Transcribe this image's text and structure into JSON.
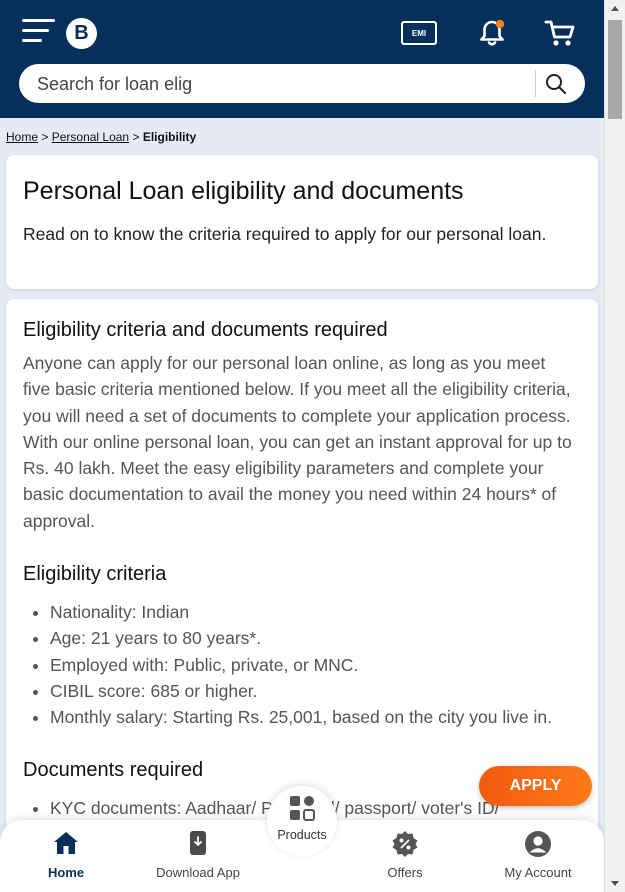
{
  "header": {
    "emi_label": "EMI",
    "logo_letter": "B",
    "search_placeholder": "Search for loan elig"
  },
  "breadcrumb": {
    "items": [
      "Home",
      "Personal Loan"
    ],
    "separator": ">",
    "current": "Eligibility"
  },
  "intro_card": {
    "title": "Personal Loan eligibility and documents",
    "text": "Read on to know the criteria required to apply for our personal loan."
  },
  "content": {
    "section1_heading": "Eligibility criteria and documents required",
    "section1_text": "Anyone can apply for our personal loan online, as long as you meet five basic criteria mentioned below. If you meet all the eligibility criteria, you will need a set of documents to complete your application process. With our online personal loan, you can get an instant approval for up to Rs. 40 lakh. Meet the easy eligibility parameters and complete your basic documentation to avail the money you need within 24 hours* of approval.",
    "eligibility_heading": "Eligibility criteria",
    "eligibility_items": [
      "Nationality: Indian",
      "Age: 21 years to 80 years*.",
      "Employed with: Public, private, or MNC.",
      "CIBIL score: 685 or higher.",
      "Monthly salary: Starting Rs. 25,001, based on the city you live in."
    ],
    "documents_heading": "Documents required",
    "documents_items": [
      "KYC documents: Aadhaar/ PAN card/ passport/ voter's ID/"
    ]
  },
  "apply_button": "APPLY",
  "bottom_nav": {
    "home": "Home",
    "download": "Download App",
    "products": "Products",
    "offers": "Offers",
    "account": "My Account"
  },
  "colors": {
    "header_bg": "#06305b",
    "accent": "#f25a10",
    "notification_dot": "#f58220"
  }
}
